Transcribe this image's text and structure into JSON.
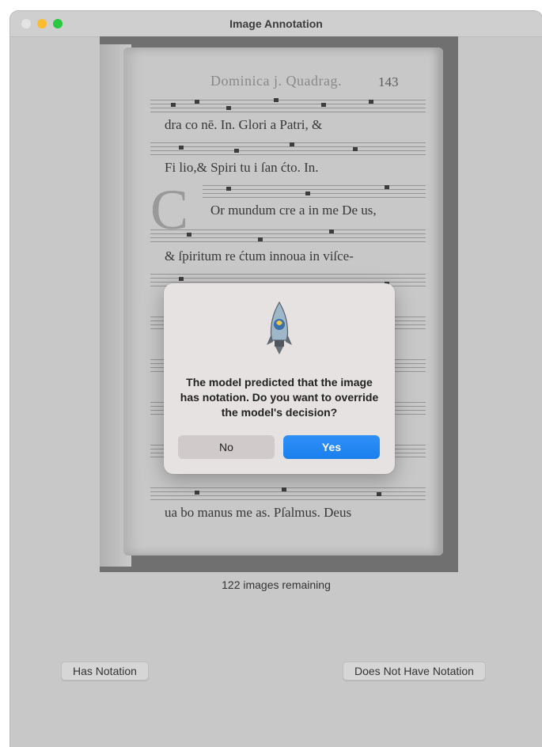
{
  "window": {
    "title": "Image Annotation"
  },
  "scan": {
    "header": "Dominica j. Quadrag.",
    "page_number": "143",
    "lyrics": [
      "dra co    nē. In. Glori a Patri, &",
      "Fi lio,& Spiri tu i ſan    ćto. In.",
      "Or mundum cre a in me De us,",
      "& ſpiritum re ćtum innoua in viſce-",
      "ua bo manus me as.  Pſalmus. Deus"
    ]
  },
  "status": {
    "remaining_text": "122 images remaining"
  },
  "buttons": {
    "has_notation": "Has Notation",
    "does_not_have_notation": "Does Not Have Notation"
  },
  "dialog": {
    "message": "The model predicted that the image has notation. Do you want to override the model's decision?",
    "no_label": "No",
    "yes_label": "Yes",
    "accent_color": "#1f86f2"
  }
}
